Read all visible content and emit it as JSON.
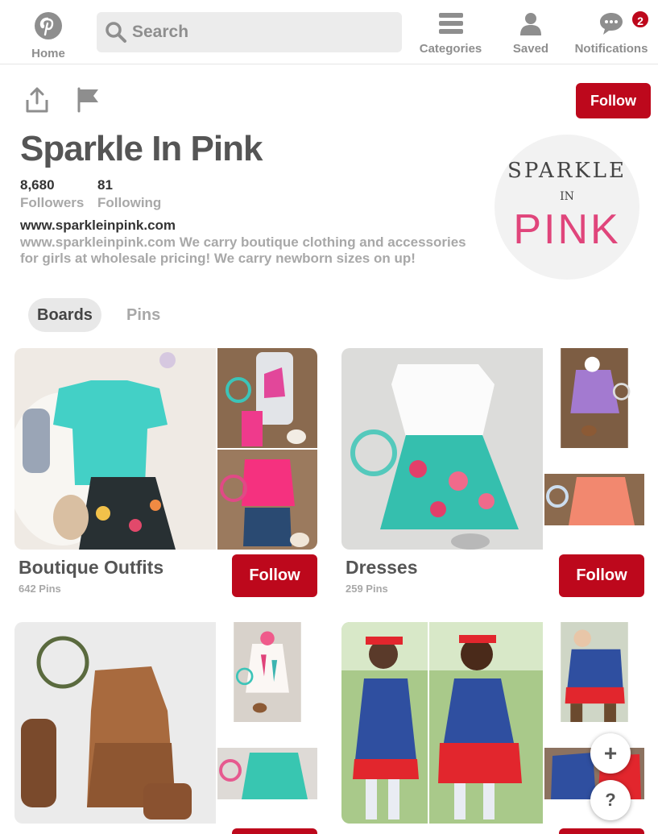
{
  "nav": {
    "home": "Home",
    "search_placeholder": "Search",
    "categories": "Categories",
    "saved": "Saved",
    "notifications": "Notifications",
    "notification_count": "2"
  },
  "profile": {
    "follow_label": "Follow",
    "name": "Sparkle In Pink",
    "followers_count": "8,680",
    "followers_label": "Followers",
    "following_count": "81",
    "following_label": "Following",
    "website": "www.sparkleinpink.com",
    "bio": "www.sparkleinpink.com We carry boutique clothing and accessories for girls at wholesale pricing! We carry newborn sizes on up!",
    "avatar_logo": [
      "SPARKLE",
      "IN",
      "PINK"
    ]
  },
  "tabs": {
    "boards": "Boards",
    "pins": "Pins"
  },
  "boards": [
    {
      "title": "Boutique Outfits",
      "count": "642 Pins",
      "follow": "Follow"
    },
    {
      "title": "Dresses",
      "count": "259 Pins",
      "follow": "Follow"
    },
    {
      "title": "",
      "count": "",
      "follow": ""
    },
    {
      "title": "",
      "count": "",
      "follow": ""
    }
  ],
  "fab": {
    "plus": "+",
    "help": "?"
  },
  "colors": {
    "accent": "#bd081c",
    "logo_pink": "#e0457b"
  }
}
